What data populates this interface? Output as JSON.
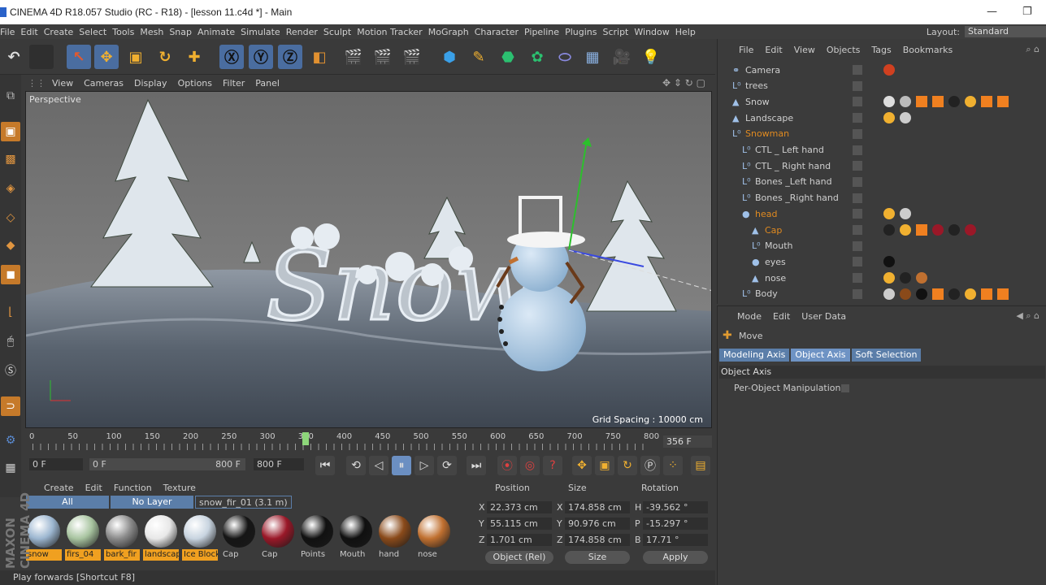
{
  "window": {
    "title": "CINEMA 4D R18.057 Studio (RC - R18) - [lesson 11.c4d *] - Main",
    "minimize": "—",
    "maximize": "❐"
  },
  "menubar": {
    "items": [
      "File",
      "Edit",
      "Create",
      "Select",
      "Tools",
      "Mesh",
      "Snap",
      "Animate",
      "Simulate",
      "Render",
      "Sculpt",
      "Motion Tracker",
      "MoGraph",
      "Character",
      "Pipeline",
      "Plugins",
      "Script",
      "Window",
      "Help"
    ],
    "layout_label": "Layout:",
    "layout_value": "Standard"
  },
  "viewport": {
    "menu": [
      "View",
      "Cameras",
      "Display",
      "Options",
      "Filter",
      "Panel"
    ],
    "label": "Perspective",
    "grid_spacing": "Grid Spacing : 10000 cm",
    "scene_text": "Snow"
  },
  "timeline": {
    "ticks": [
      "0",
      "50",
      "100",
      "150",
      "200",
      "250",
      "300",
      "350",
      "400",
      "450",
      "500",
      "550",
      "600",
      "650",
      "700",
      "750",
      "800"
    ],
    "current_frame": 356,
    "max_frame": 800,
    "frame_field": "356 F"
  },
  "transport": {
    "start_field": "0 F",
    "range_start": "0 F",
    "range_end": "800 F",
    "end_field": "800 F"
  },
  "material_manager": {
    "menu": [
      "Create",
      "Edit",
      "Function",
      "Texture"
    ],
    "tabs": [
      "All",
      "No Layer"
    ],
    "current_tab": "snow_fir_01 (3.1 m)",
    "materials": [
      {
        "name": "snow",
        "color": "#9cb6d0",
        "highlight": true
      },
      {
        "name": "firs_04",
        "color": "#a8c4a0",
        "highlight": true
      },
      {
        "name": "bark_fir",
        "color": "#8a8a8a",
        "highlight": true
      },
      {
        "name": "landscap",
        "color": "#e8e8e8",
        "highlight": true
      },
      {
        "name": "Ice Block",
        "color": "#c8d4e0",
        "highlight": true
      },
      {
        "name": "Cap",
        "color": "#151515",
        "highlight": false
      },
      {
        "name": "Cap",
        "color": "#9a1828",
        "highlight": false
      },
      {
        "name": "Points",
        "color": "#111111",
        "highlight": false
      },
      {
        "name": "Mouth",
        "color": "#101010",
        "highlight": false
      },
      {
        "name": "hand",
        "color": "#8a4a1a",
        "highlight": false
      },
      {
        "name": "nose",
        "color": "#c07030",
        "highlight": false
      }
    ]
  },
  "coordinates": {
    "headers": [
      "Position",
      "Size",
      "Rotation"
    ],
    "rows": [
      {
        "axis": "X",
        "pos": "22.373 cm",
        "saxis": "X",
        "size": "174.858 cm",
        "raxis": "H",
        "rot": "-39.562 °"
      },
      {
        "axis": "Y",
        "pos": "55.115 cm",
        "saxis": "Y",
        "size": "90.976 cm",
        "raxis": "P",
        "rot": "-15.297 °"
      },
      {
        "axis": "Z",
        "pos": "1.701 cm",
        "saxis": "Z",
        "size": "174.858 cm",
        "raxis": "B",
        "rot": "17.71 °"
      }
    ],
    "mode_select": "Object (Rel)",
    "size_select": "Size",
    "apply": "Apply"
  },
  "object_manager": {
    "menu": [
      "File",
      "Edit",
      "View",
      "Objects",
      "Tags",
      "Bookmarks"
    ],
    "objects": [
      {
        "name": "Camera",
        "indent": 0,
        "highlight": false
      },
      {
        "name": "trees",
        "indent": 0,
        "highlight": false
      },
      {
        "name": "Snow",
        "indent": 0,
        "highlight": false
      },
      {
        "name": "Landscape",
        "indent": 0,
        "highlight": false
      },
      {
        "name": "Snowman",
        "indent": 0,
        "highlight": true
      },
      {
        "name": "CTL _ Left hand",
        "indent": 1,
        "highlight": false
      },
      {
        "name": "CTL _ Right hand",
        "indent": 1,
        "highlight": false
      },
      {
        "name": "Bones _Left hand",
        "indent": 1,
        "highlight": false
      },
      {
        "name": "Bones _Right hand",
        "indent": 1,
        "highlight": false
      },
      {
        "name": "head",
        "indent": 1,
        "highlight": true
      },
      {
        "name": "Cap",
        "indent": 2,
        "highlight": true
      },
      {
        "name": "Mouth",
        "indent": 2,
        "highlight": false
      },
      {
        "name": "eyes",
        "indent": 2,
        "highlight": false
      },
      {
        "name": "nose",
        "indent": 2,
        "highlight": false
      },
      {
        "name": "Body",
        "indent": 1,
        "highlight": false
      }
    ]
  },
  "attribute_manager": {
    "menu": [
      "Mode",
      "Edit",
      "User Data"
    ],
    "tool": "Move",
    "tabs": [
      "Modeling Axis",
      "Object Axis",
      "Soft Selection"
    ],
    "active_tab": "Object Axis",
    "section": "Object Axis",
    "option": "Per-Object Manipulation"
  },
  "status": "Play forwards [Shortcut F8]",
  "brand": "MAXON CINEMA 4D"
}
